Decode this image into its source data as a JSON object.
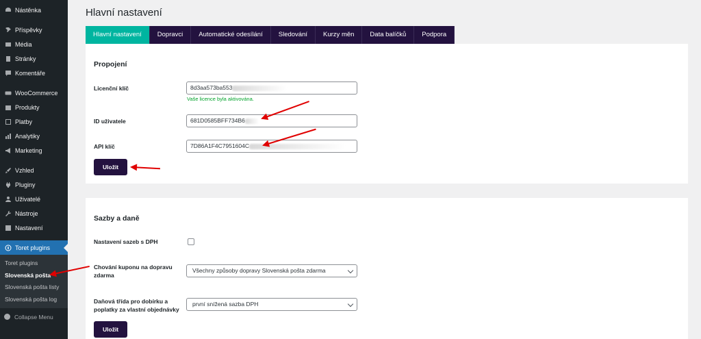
{
  "sidebar": {
    "items": [
      {
        "label": "Nástěnka",
        "icon": "dashboard-icon"
      },
      {
        "label": "Příspěvky",
        "icon": "pin-icon"
      },
      {
        "label": "Média",
        "icon": "media-icon"
      },
      {
        "label": "Stránky",
        "icon": "pages-icon"
      },
      {
        "label": "Komentáře",
        "icon": "comments-icon"
      },
      {
        "label": "WooCommerce",
        "icon": "woocommerce-icon"
      },
      {
        "label": "Produkty",
        "icon": "products-icon"
      },
      {
        "label": "Platby",
        "icon": "payments-icon"
      },
      {
        "label": "Analytiky",
        "icon": "analytics-icon"
      },
      {
        "label": "Marketing",
        "icon": "megaphone-icon"
      },
      {
        "label": "Vzhled",
        "icon": "brush-icon"
      },
      {
        "label": "Pluginy",
        "icon": "plug-icon"
      },
      {
        "label": "Uživatelé",
        "icon": "users-icon"
      },
      {
        "label": "Nástroje",
        "icon": "wrench-icon"
      },
      {
        "label": "Nastavení",
        "icon": "settings-icon"
      },
      {
        "label": "Toret plugins",
        "icon": "toret-icon"
      }
    ],
    "submenu": [
      "Toret plugins",
      "Slovenská pošta",
      "Slovenská pošta listy",
      "Slovenská pošta log"
    ],
    "collapse": "Collapse Menu"
  },
  "page": {
    "title": "Hlavní nastavení"
  },
  "tabs": [
    "Hlavní nastavení",
    "Dopravci",
    "Automatické odesílání",
    "Sledování",
    "Kurzy měn",
    "Data balíčků",
    "Podpora"
  ],
  "connection": {
    "heading": "Propojení",
    "license_label": "Licenční klíč",
    "license_value": "8d3aa573ba553",
    "license_hint": "Vaše licence byla aktivována.",
    "user_id_label": "ID uživatele",
    "user_id_value": "681D0585BFF734B6",
    "api_key_label": "API klíč",
    "api_key_value": "7D86A1F4C7951604C",
    "save": "Uložit"
  },
  "rates": {
    "heading": "Sazby a daně",
    "vat_label": "Nastavení sazeb s DPH",
    "coupon_label": "Chování kuponu na dopravu zdarma",
    "coupon_value": "Všechny způsoby dopravy Slovenská pošta zdarma",
    "tax_label": "Daňová třída pro dobírku a poplatky za vlastní objednávky",
    "tax_value": "první snížená sazba DPH",
    "save": "Uložit"
  },
  "colors": {
    "accent": "#00b5a0",
    "brand": "#23123f",
    "sidebar": "#1d2327",
    "annotation": "#e00000"
  }
}
